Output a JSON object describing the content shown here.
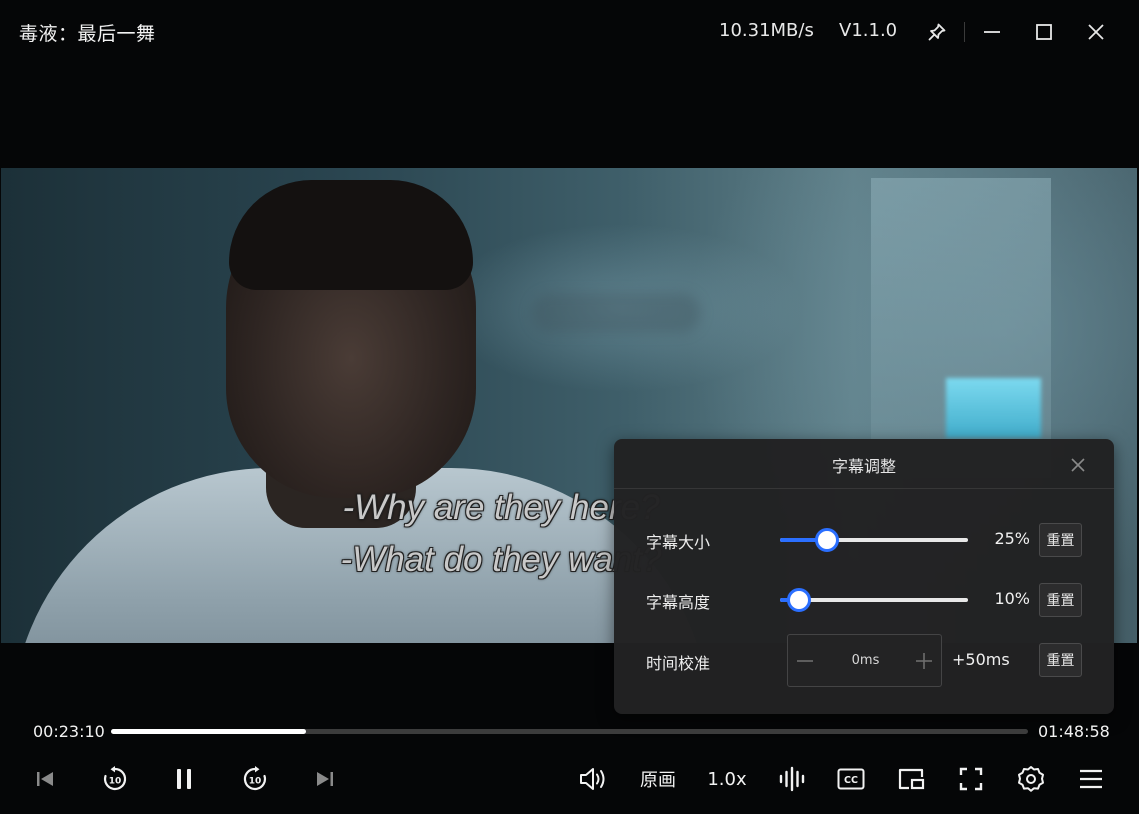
{
  "window": {
    "title": "毒液：最后一舞",
    "net_speed": "10.31MB/s",
    "version": "V1.1.0"
  },
  "subtitles": {
    "line1": "-Why are they here?",
    "line2": "-What do they want?"
  },
  "subtitle_panel": {
    "title": "字幕调整",
    "rows": [
      {
        "label": "字幕大小",
        "value_text": "25%",
        "value_fraction": 0.25,
        "reset_label": "重置"
      },
      {
        "label": "字幕高度",
        "value_text": "10%",
        "value_fraction": 0.1,
        "reset_label": "重置"
      },
      {
        "label": "时间校准",
        "stepper_value": "0ms",
        "step_size": "+50ms",
        "reset_label": "重置"
      }
    ]
  },
  "playback": {
    "current_time": "00:23:10",
    "total_time": "01:48:58",
    "progress_fraction": 0.2125
  },
  "controls": {
    "quality_label": "原画",
    "speed_label": "1.0x",
    "cc_label": "CC"
  },
  "colors": {
    "accent": "#2b6fff",
    "panel_bg": "#222223",
    "progress_fill": "#ffffff"
  },
  "icons": [
    "pin-icon",
    "minimize-icon",
    "maximize-icon",
    "close-icon",
    "skip-previous-icon",
    "rewind-10-icon",
    "pause-icon",
    "forward-10-icon",
    "skip-next-icon",
    "volume-icon",
    "audio-track-icon",
    "cc-icon",
    "picture-in-picture-icon",
    "fullscreen-icon",
    "settings-icon",
    "playlist-icon"
  ]
}
